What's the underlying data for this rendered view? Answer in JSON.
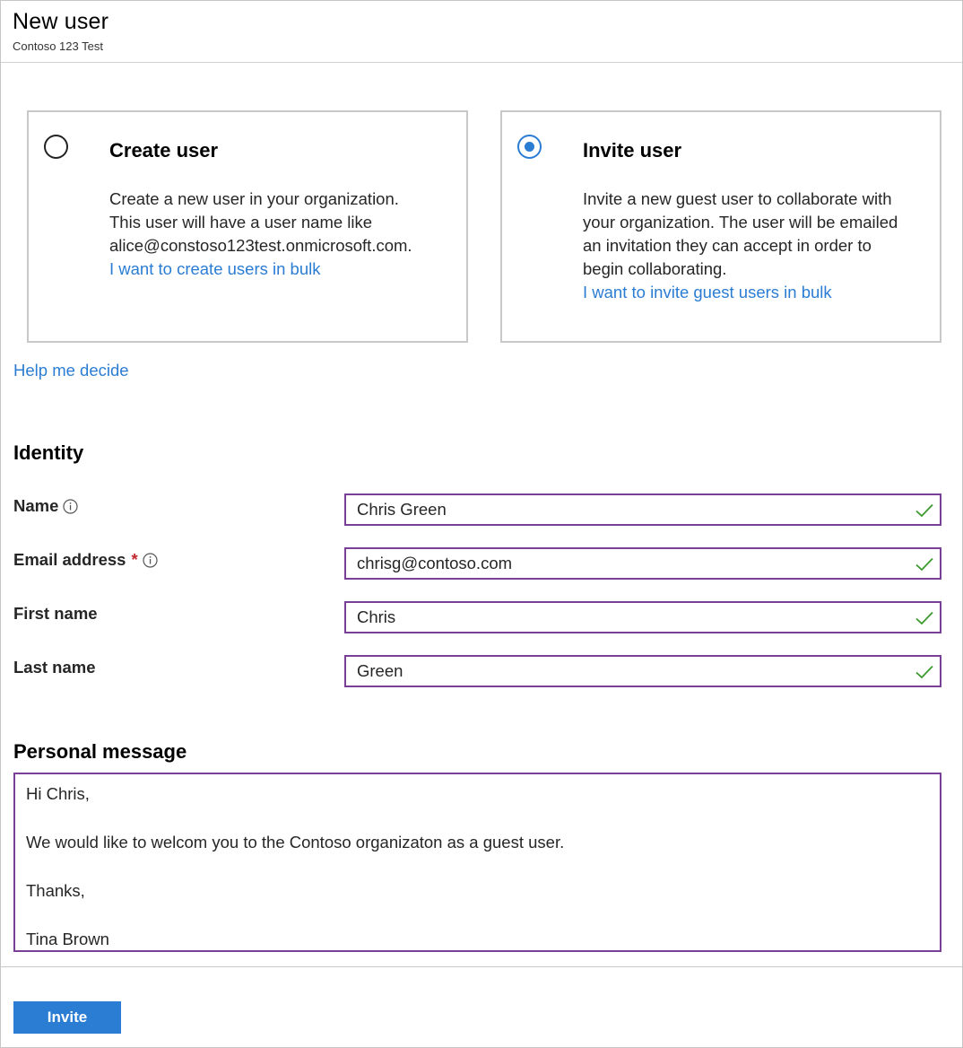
{
  "header": {
    "title": "New user",
    "subtitle": "Contoso 123 Test"
  },
  "options": {
    "create": {
      "title": "Create user",
      "lines": [
        "Create a new user in your organization.",
        "This user will have a user name like",
        "alice@constoso123test.onmicrosoft.com."
      ],
      "link": "I want to create users in bulk",
      "selected": false
    },
    "invite": {
      "title": "Invite user",
      "lines": [
        "Invite a new guest user to collaborate with",
        "your organization. The user will be emailed",
        "an invitation they can accept in order to",
        "begin collaborating."
      ],
      "link": "I want to invite guest users in bulk",
      "selected": true
    }
  },
  "help_link": "Help me decide",
  "identity": {
    "heading": "Identity",
    "fields": {
      "name": {
        "label": "Name",
        "value": "Chris Green",
        "has_info": true,
        "required": false
      },
      "email": {
        "label": "Email address",
        "value": "chrisg@contoso.com",
        "has_info": true,
        "required": true,
        "required_mark": "*"
      },
      "first_name": {
        "label": "First name",
        "value": "Chris",
        "has_info": false,
        "required": false
      },
      "last_name": {
        "label": "Last name",
        "value": "Green",
        "has_info": false,
        "required": false
      }
    }
  },
  "personal_message": {
    "heading": "Personal message",
    "lines": [
      "Hi Chris,",
      "We would like to welcom you to the Contoso organizaton as a guest user.",
      "Thanks,",
      "Tina Brown"
    ]
  },
  "actions": {
    "invite_label": "Invite"
  },
  "colors": {
    "accent": "#2b7cd3",
    "input_border": "#7a3f96",
    "valid_check": "#3c9a2e",
    "required": "#c4262e"
  },
  "icons": {
    "info": "info-icon",
    "valid": "checkmark-icon"
  }
}
